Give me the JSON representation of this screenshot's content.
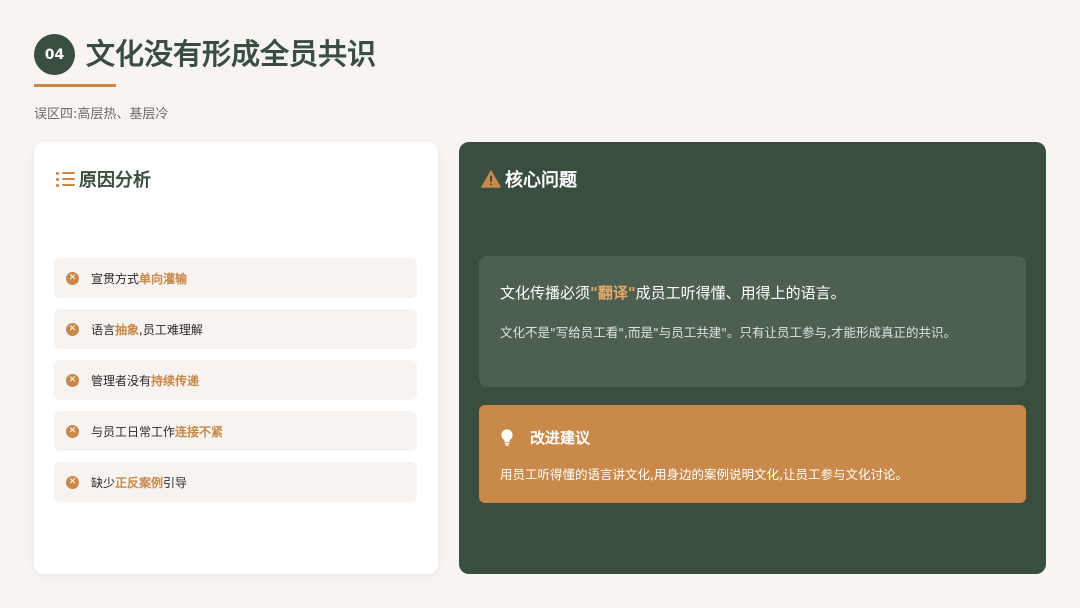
{
  "header": {
    "number": "04",
    "title": "文化没有形成全员共识",
    "subtitle": "误区四:高层热、基层冷"
  },
  "left_panel": {
    "title": "原因分析",
    "icon": "list-icon",
    "items": [
      {
        "pre": "宣贯方式",
        "hl": "单向灌输",
        "post": ""
      },
      {
        "pre": "语言",
        "hl": "抽象",
        "post": ",员工难理解"
      },
      {
        "pre": "管理者没有",
        "hl": "持续传递",
        "post": ""
      },
      {
        "pre": "与员工日常工作",
        "hl": "连接不紧",
        "post": ""
      },
      {
        "pre": "缺少",
        "hl": "正反案例",
        "post": "引导"
      }
    ]
  },
  "right_panel": {
    "title": "核心问题",
    "icon": "warning-icon",
    "core": {
      "pre": "文化传播必须",
      "hl": "\"翻译\"",
      "post": "成员工听得懂、用得上的语言。",
      "desc": "文化不是\"写给员工看\",而是\"与员工共建\"。只有让员工参与,才能形成真正的共识。"
    },
    "suggestion": {
      "icon": "lightbulb-icon",
      "title": "改进建议",
      "text": "用员工听得懂的语言讲文化,用身边的案例说明文化,让员工参与文化讨论。"
    }
  },
  "colors": {
    "primary_green": "#3a4e40",
    "accent_orange": "#c8894a",
    "background": "#f7f4f2"
  }
}
